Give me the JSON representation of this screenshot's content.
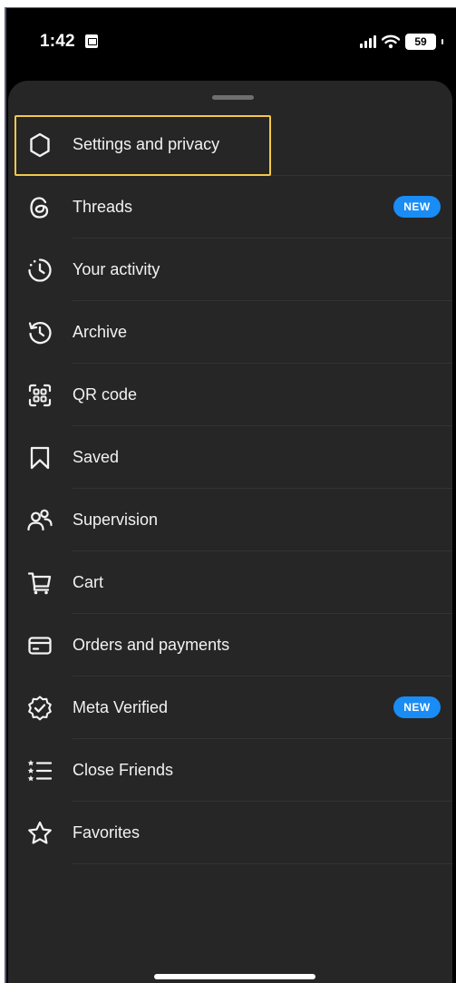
{
  "status_bar": {
    "time": "1:42",
    "battery": "59"
  },
  "menu": {
    "items": [
      {
        "label": "Settings and privacy",
        "icon": "settings-gear-icon"
      },
      {
        "label": "Threads",
        "icon": "threads-icon",
        "badge": "NEW"
      },
      {
        "label": "Your activity",
        "icon": "activity-clock-icon"
      },
      {
        "label": "Archive",
        "icon": "archive-history-icon"
      },
      {
        "label": "QR code",
        "icon": "qr-code-icon"
      },
      {
        "label": "Saved",
        "icon": "bookmark-icon"
      },
      {
        "label": "Supervision",
        "icon": "supervision-people-icon"
      },
      {
        "label": "Cart",
        "icon": "cart-icon"
      },
      {
        "label": "Orders and payments",
        "icon": "credit-card-icon"
      },
      {
        "label": "Meta Verified",
        "icon": "verified-badge-icon",
        "badge": "NEW"
      },
      {
        "label": "Close Friends",
        "icon": "close-friends-list-icon"
      },
      {
        "label": "Favorites",
        "icon": "star-icon"
      }
    ]
  },
  "colors": {
    "sheet_background": "#262626",
    "badge": "#1a8cf5",
    "highlight": "#f2c94c"
  }
}
